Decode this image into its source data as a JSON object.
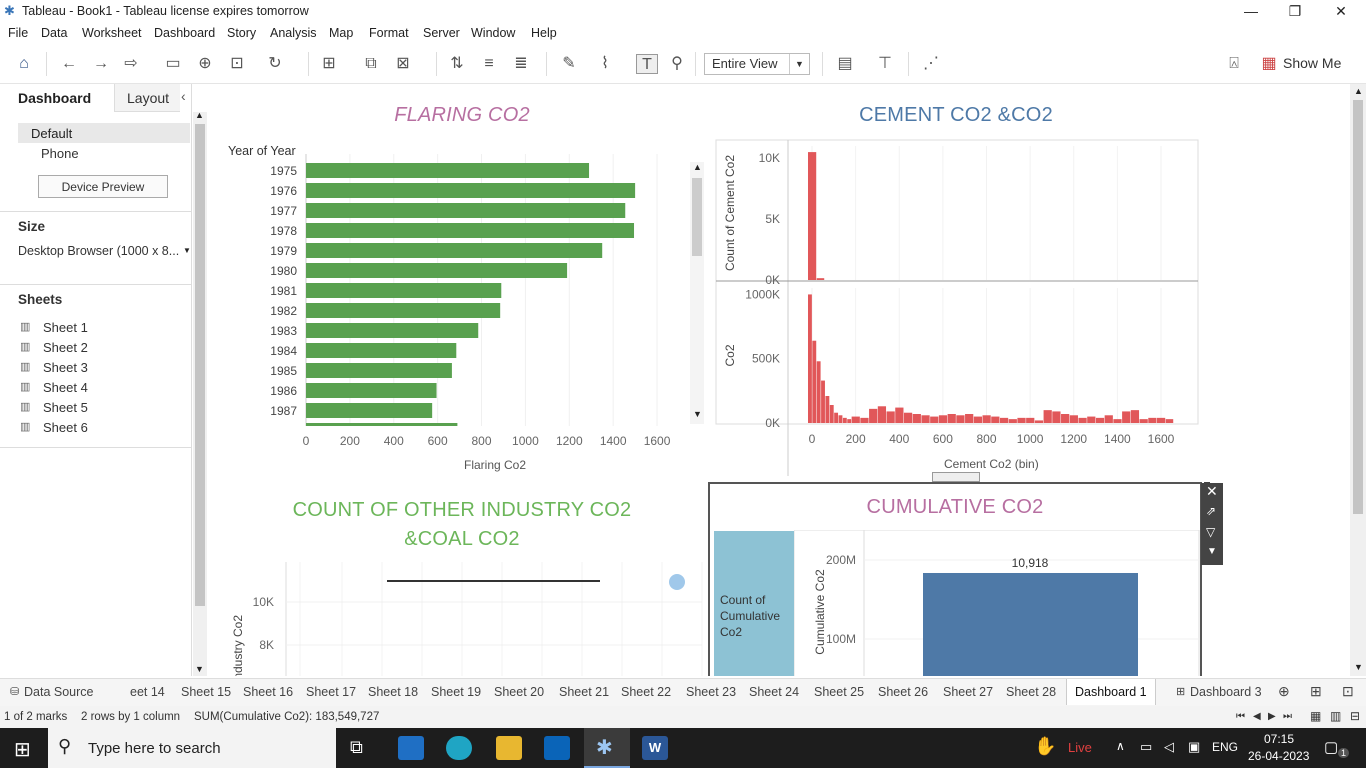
{
  "window": {
    "title": "Tableau - Book1 - Tableau license expires tomorrow",
    "minimize": "—",
    "restore": "❐",
    "close": "✕"
  },
  "menu": [
    "File",
    "Data",
    "Worksheet",
    "Dashboard",
    "Story",
    "Analysis",
    "Map",
    "Format",
    "Server",
    "Window",
    "Help"
  ],
  "toolbar": {
    "fit_value": "Entire View",
    "show_me_label": "Show Me"
  },
  "left_pane": {
    "tabs": {
      "dashboard": "Dashboard",
      "layout": "Layout"
    },
    "devices": [
      "Default",
      "Phone"
    ],
    "device_preview_label": "Device Preview",
    "size_heading": "Size",
    "size_value": "Desktop Browser (1000 x 8...",
    "sheets_heading": "Sheets",
    "sheets": [
      "Sheet 1",
      "Sheet 2",
      "Sheet 3",
      "Sheet 4",
      "Sheet 5",
      "Sheet 6"
    ]
  },
  "chart_data": [
    {
      "type": "bar",
      "title": "FLARING CO2",
      "ylabel": "Year of Year",
      "xlabel": "Flaring Co2",
      "categories": [
        "1975",
        "1976",
        "1977",
        "1978",
        "1979",
        "1980",
        "1981",
        "1982",
        "1983",
        "1984",
        "1985",
        "1986",
        "1987"
      ],
      "values": [
        1290,
        1500,
        1455,
        1495,
        1350,
        1190,
        890,
        885,
        785,
        685,
        665,
        595,
        575
      ],
      "xticks": [
        0,
        200,
        400,
        600,
        800,
        1000,
        1200,
        1400,
        1600
      ],
      "xlim": [
        0,
        1700
      ],
      "orientation": "horizontal",
      "color": "#59a14f"
    },
    {
      "type": "bar",
      "title": "CEMENT CO2 &CO2",
      "xlabel": "Cement Co2 (bin)",
      "panes": [
        {
          "ylabel": "Count of Cement Co2",
          "yticks": [
            "10K",
            "5K",
            "0K"
          ],
          "ylim": [
            0,
            11000
          ],
          "x": [
            0,
            40
          ],
          "values": [
            10500,
            150
          ]
        },
        {
          "ylabel": "Co2",
          "yticks": [
            "1000K",
            "500K",
            "0K"
          ],
          "ylim": [
            0,
            1050000
          ],
          "x": [
            0,
            20,
            40,
            60,
            80,
            100,
            120,
            140,
            160,
            180,
            200,
            240,
            280,
            320,
            360,
            400,
            440,
            480,
            520,
            560,
            600,
            640,
            680,
            720,
            760,
            800,
            840,
            880,
            920,
            960,
            1000,
            1040,
            1080,
            1120,
            1160,
            1200,
            1240,
            1280,
            1320,
            1360,
            1400,
            1440,
            1480,
            1520,
            1560,
            1600,
            1640
          ],
          "values": [
            1000000,
            640000,
            480000,
            330000,
            210000,
            140000,
            80000,
            60000,
            40000,
            30000,
            50000,
            40000,
            110000,
            130000,
            90000,
            120000,
            80000,
            70000,
            60000,
            50000,
            60000,
            70000,
            60000,
            70000,
            50000,
            60000,
            50000,
            40000,
            30000,
            40000,
            40000,
            20000,
            100000,
            90000,
            70000,
            60000,
            40000,
            50000,
            40000,
            60000,
            30000,
            90000,
            100000,
            30000,
            40000,
            40000,
            30000
          ]
        }
      ],
      "xticks": [
        0,
        200,
        400,
        600,
        800,
        1000,
        1200,
        1400,
        1600
      ],
      "color": "#e15759"
    },
    {
      "type": "line",
      "title": "COUNT OF OTHER INDUSTRY CO2 &COAL CO2",
      "ylabel": "Industry Co2",
      "yticks": [
        "10K",
        "8K"
      ]
    },
    {
      "type": "bar",
      "title": "CUMULATIVE CO2",
      "row_header": "Count of Cumulative Co2",
      "ylabel": "Cumulative Co2",
      "yticks": [
        "200M",
        "100M"
      ],
      "values": [
        183549727
      ],
      "data_label": "10,918",
      "color": "#4e79a7"
    }
  ],
  "sheet_tabs": [
    "Data Source",
    "eet 14",
    "Sheet 15",
    "Sheet 16",
    "Sheet 17",
    "Sheet 18",
    "Sheet 19",
    "Sheet 20",
    "Sheet 21",
    "Sheet 22",
    "Sheet 23",
    "Sheet 24",
    "Sheet 25",
    "Sheet 26",
    "Sheet 27",
    "Sheet 28",
    "Dashboard 1",
    "Dashboard 3"
  ],
  "status": {
    "marks": "1 of 2 marks",
    "rows": "2 rows by 1 column",
    "sum": "SUM(Cumulative Co2): 183,549,727"
  },
  "taskbar": {
    "search_placeholder": "Type here to search",
    "live": "Live",
    "lang": "ENG",
    "time": "07:15",
    "date": "26-04-2023",
    "notif": "1"
  },
  "colors": {
    "flaring_title": "#b76fa1",
    "cement_title": "#4e79a7",
    "industry_title": "#6cb65a",
    "cumulative_title": "#b76fa1",
    "row_header_bg": "#8dc2d4"
  }
}
